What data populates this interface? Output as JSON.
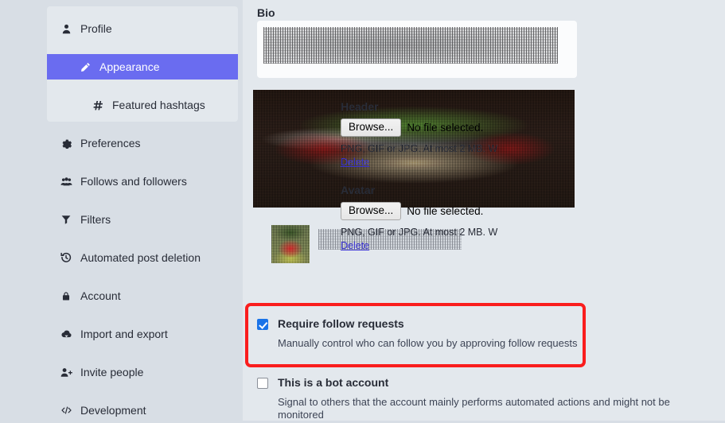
{
  "theme": {
    "page_bg": "#d8dee5",
    "panel_bg": "#e3e8ed",
    "accent_purple": "#6a6cf0",
    "checkbox_blue": "#1a73e8",
    "link_blue": "#3e36d6",
    "highlight_red": "#fa1d1d",
    "text": "#282c37"
  },
  "sidebar": {
    "items": [
      {
        "label": "Profile",
        "icon": "person-icon",
        "active": false,
        "sub": false
      },
      {
        "label": "Appearance",
        "icon": "pencil-icon",
        "active": true,
        "sub": true
      },
      {
        "label": "Featured hashtags",
        "icon": "hashtag-icon",
        "active": false,
        "sub": true
      },
      {
        "label": "Preferences",
        "icon": "gear-icon",
        "active": false,
        "sub": false
      },
      {
        "label": "Follows and followers",
        "icon": "people-icon",
        "active": false,
        "sub": false
      },
      {
        "label": "Filters",
        "icon": "funnel-icon",
        "active": false,
        "sub": false
      },
      {
        "label": "Automated post deletion",
        "icon": "history-icon",
        "active": false,
        "sub": false
      },
      {
        "label": "Account",
        "icon": "lock-icon",
        "active": false,
        "sub": false
      },
      {
        "label": "Import and export",
        "icon": "cloud-upload-icon",
        "active": false,
        "sub": false
      },
      {
        "label": "Invite people",
        "icon": "person-add-icon",
        "active": false,
        "sub": false
      },
      {
        "label": "Development",
        "icon": "code-icon",
        "active": false,
        "sub": false
      }
    ]
  },
  "main": {
    "bio": {
      "label": "Bio"
    },
    "header_upload": {
      "label": "Header",
      "browse_label": "Browse...",
      "file_status": "No file selected.",
      "hint": "PNG, GIF or JPG. At most 2 MB. W",
      "delete_label": "Delete"
    },
    "avatar_upload": {
      "label": "Avatar",
      "browse_label": "Browse...",
      "file_status": "No file selected.",
      "hint": "PNG, GIF or JPG. At most 2 MB. W",
      "delete_label": "Delete"
    },
    "checkboxes": [
      {
        "title": "Require follow requests",
        "description": "Manually control who can follow you by approving follow requests",
        "checked": true,
        "highlighted": true
      },
      {
        "title": "This is a bot account",
        "description": "Signal to others that the account mainly performs automated actions and might not be monitored",
        "checked": false,
        "highlighted": false
      }
    ]
  }
}
